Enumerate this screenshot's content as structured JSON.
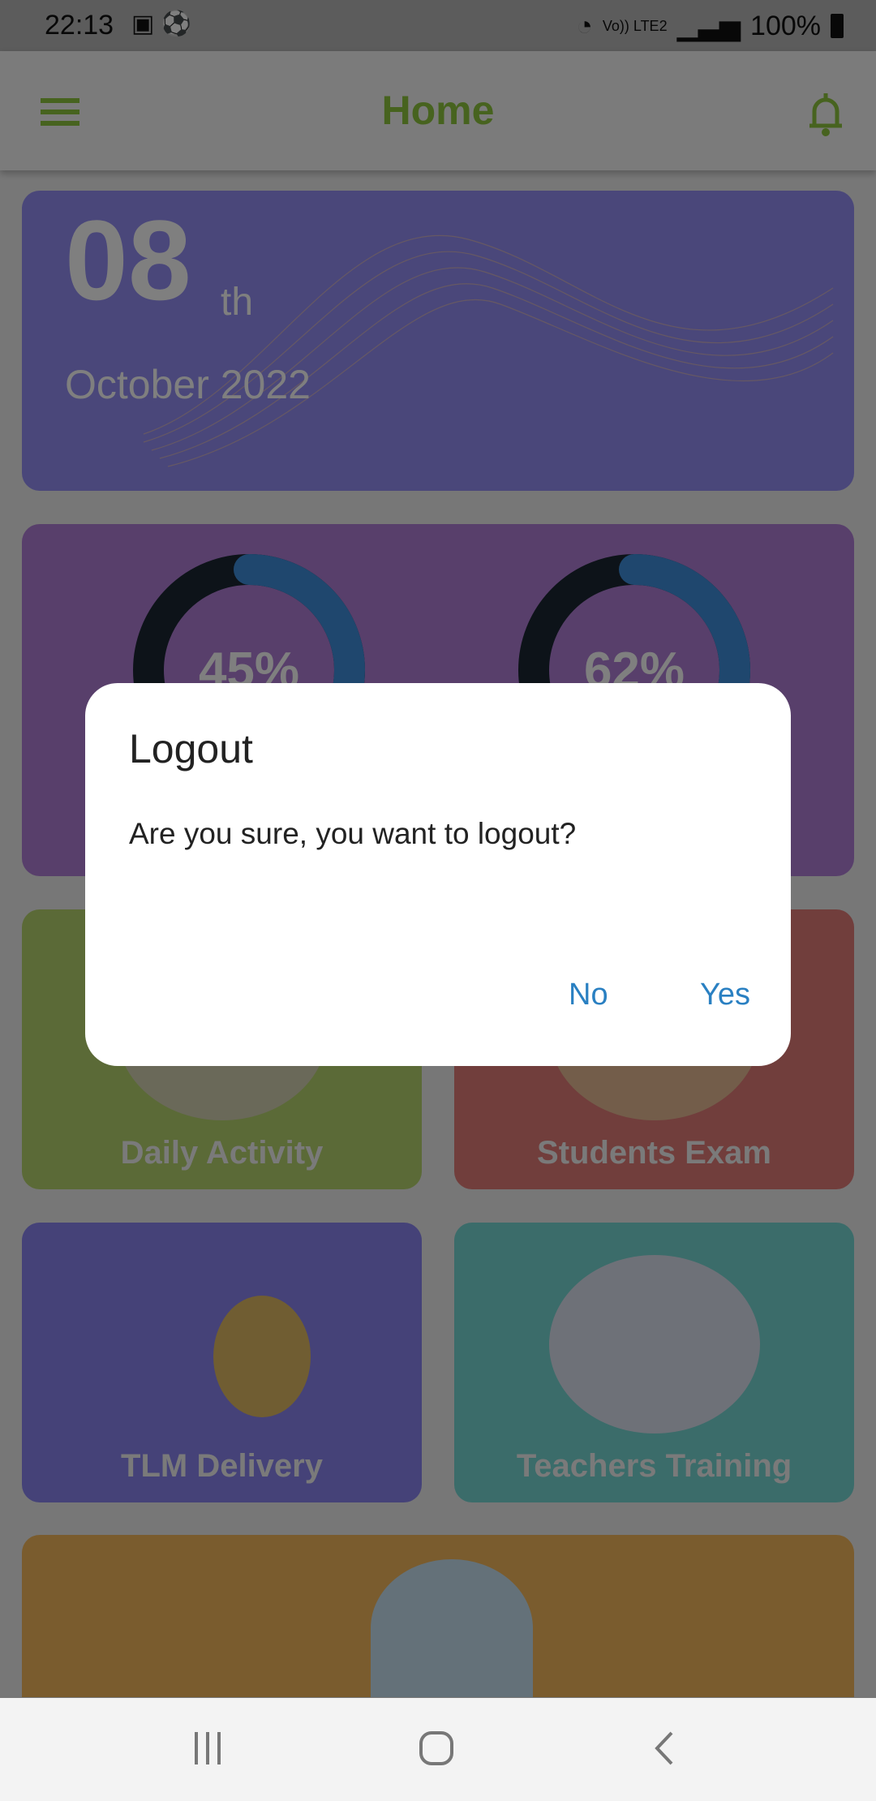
{
  "status_bar": {
    "time": "22:13",
    "battery": "100%",
    "network": "Vo)) LTE2"
  },
  "app_bar": {
    "title": "Home"
  },
  "date_card": {
    "day": "08",
    "suffix": "th",
    "month_year": "October 2022"
  },
  "progress": [
    {
      "label": "45%",
      "value": 45
    },
    {
      "label": "62%",
      "value": 62
    }
  ],
  "tiles": [
    {
      "label": "Daily Activity",
      "color": "#b6d46e"
    },
    {
      "label": "Students Exam",
      "color": "#e27c79"
    },
    {
      "label": "TLM Delivery",
      "color": "#8a85f0"
    },
    {
      "label": "Teachers Training",
      "color": "#76d8d4"
    }
  ],
  "dialog": {
    "title": "Logout",
    "message": "Are you sure, you want to logout?",
    "no": "No",
    "yes": "Yes"
  },
  "colors": {
    "accent": "#8ec63f",
    "dialog_button": "#2a80c2"
  }
}
